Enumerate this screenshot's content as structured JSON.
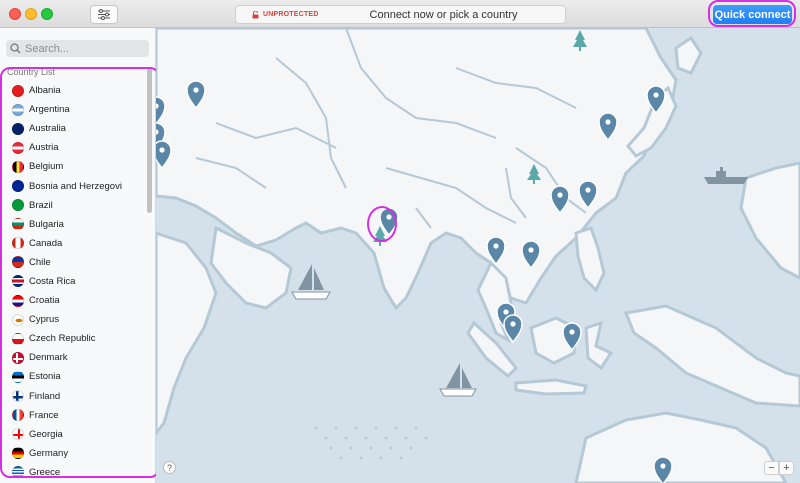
{
  "titlebar": {
    "status": "UNPROTECTED",
    "message": "Connect now or pick a country",
    "quick_connect": "Quick connect"
  },
  "sidebar": {
    "search_placeholder": "Search...",
    "list_header": "Country List",
    "countries": [
      {
        "name": "Albania",
        "flag": "albania"
      },
      {
        "name": "Argentina",
        "flag": "argentina"
      },
      {
        "name": "Australia",
        "flag": "australia"
      },
      {
        "name": "Austria",
        "flag": "austria"
      },
      {
        "name": "Belgium",
        "flag": "belgium"
      },
      {
        "name": "Bosnia and Herzegovi",
        "flag": "bosnia"
      },
      {
        "name": "Brazil",
        "flag": "brazil"
      },
      {
        "name": "Bulgaria",
        "flag": "bulgaria"
      },
      {
        "name": "Canada",
        "flag": "canada"
      },
      {
        "name": "Chile",
        "flag": "chile"
      },
      {
        "name": "Costa Rica",
        "flag": "costa-rica"
      },
      {
        "name": "Croatia",
        "flag": "croatia"
      },
      {
        "name": "Cyprus",
        "flag": "cyprus"
      },
      {
        "name": "Czech Republic",
        "flag": "czech"
      },
      {
        "name": "Denmark",
        "flag": "denmark"
      },
      {
        "name": "Estonia",
        "flag": "estonia"
      },
      {
        "name": "Finland",
        "flag": "finland"
      },
      {
        "name": "France",
        "flag": "france"
      },
      {
        "name": "Georgia",
        "flag": "georgia"
      },
      {
        "name": "Germany",
        "flag": "germany"
      },
      {
        "name": "Greece",
        "flag": "greece"
      }
    ]
  },
  "map": {
    "help_label": "?",
    "zoom_out": "−",
    "zoom_in": "+"
  },
  "colors": {
    "ocean": "#d5e1ea",
    "land": "#f4f6f8",
    "pin": "#5a87a8",
    "accent": "#2b8af7",
    "unprotected": "#e0403b"
  }
}
